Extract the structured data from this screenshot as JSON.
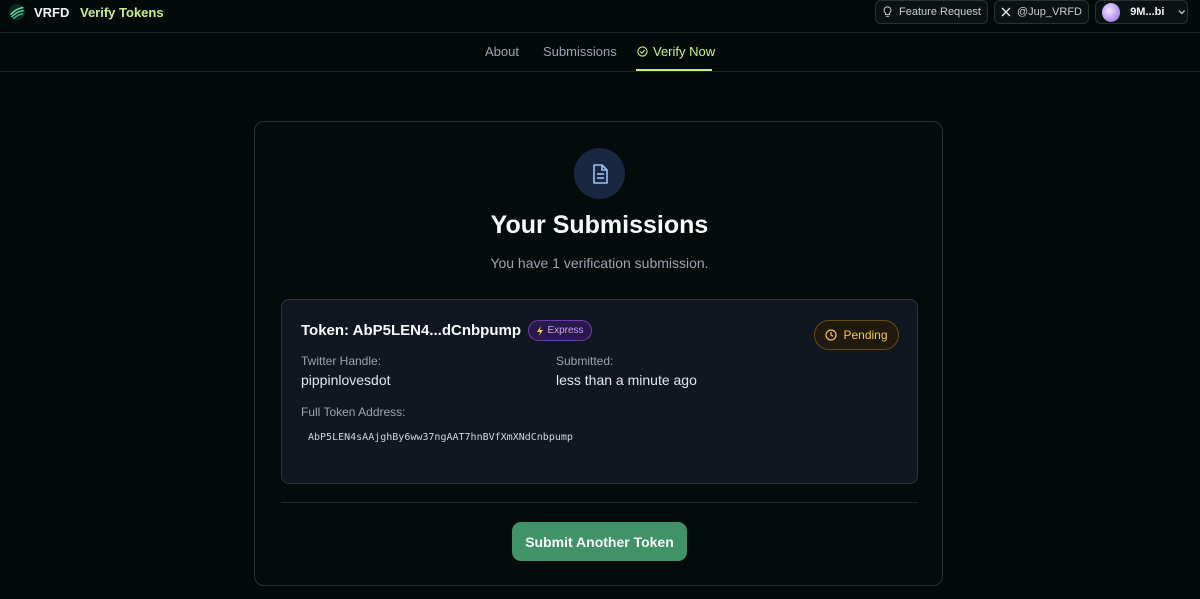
{
  "header": {
    "brand": "VRFD",
    "section": "Verify Tokens",
    "feature_request": "Feature Request",
    "twitter_handle": "@Jup_VRFD",
    "wallet": "9M...bi"
  },
  "tabs": [
    {
      "label": "About"
    },
    {
      "label": "Submissions"
    },
    {
      "label": "Verify Now",
      "active": true
    }
  ],
  "main": {
    "title": "Your Submissions",
    "subtitle": "You have 1 verification submission.",
    "submission": {
      "token_label": "Token: AbP5LEN4...dCnbpump",
      "badge": "Express",
      "status": "Pending",
      "twitter_label": "Twitter Handle:",
      "twitter_value": "pippinlovesdot",
      "submitted_label": "Submitted:",
      "submitted_value": "less than a minute ago",
      "address_label": "Full Token Address:",
      "address_value": "AbP5LEN4sAAjghBy6ww37ngAAT7hnBVfXmXNdCnbpump"
    },
    "submit_button": "Submit Another Token"
  },
  "colors": {
    "accent": "#c6f08b",
    "button": "#3f9366",
    "pending": "#f3c44a",
    "express": "#c8a4f5"
  },
  "icons": [
    "logo-icon",
    "lightbulb-icon",
    "x-logo-icon",
    "chevron-down-icon",
    "check-circle-icon",
    "document-icon",
    "lightning-icon",
    "clock-icon"
  ]
}
